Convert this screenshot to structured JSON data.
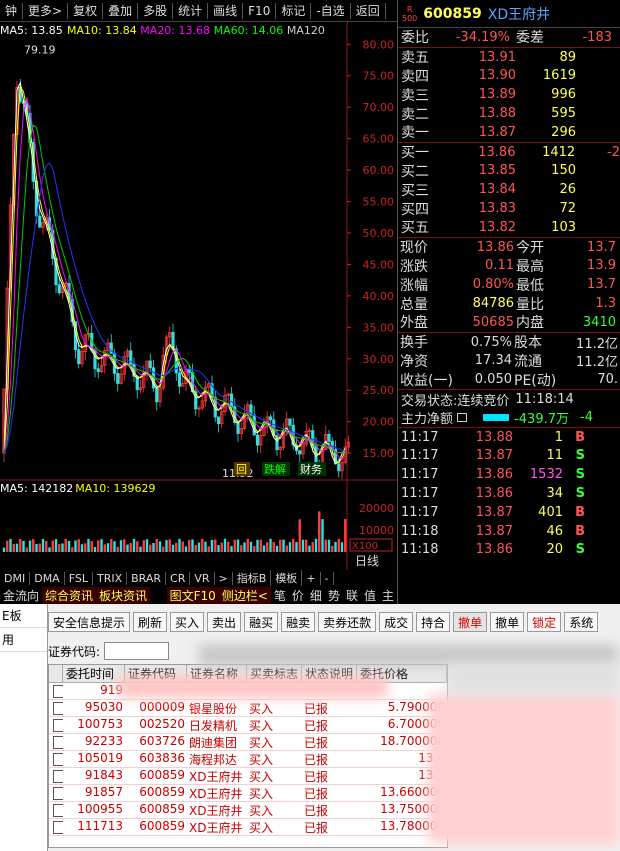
{
  "toolbar": {
    "items": [
      "钟",
      "更多>",
      "复权",
      "叠加",
      "多股",
      "统计",
      "画线",
      "F10",
      "标记",
      "-自选",
      "返回"
    ]
  },
  "chart": {
    "ma_legend": [
      {
        "label": "MA5: 13.85",
        "color": "#ffffff"
      },
      {
        "label": "MA10: 13.84",
        "color": "#ffff00"
      },
      {
        "label": "MA20: 13.68",
        "color": "#ff00ff"
      },
      {
        "label": "MA60: 14.06",
        "color": "#00ff00"
      },
      {
        "label": "MA120",
        "color": "#cccccc"
      }
    ],
    "y_ticks": [
      "80.00",
      "75.00",
      "70.00",
      "65.00",
      "60.00",
      "55.00",
      "50.00",
      "45.00",
      "40.00",
      "35.00",
      "30.00",
      "25.00",
      "20.00",
      "15.00"
    ],
    "high_label": "79.19",
    "low_label": "11.52",
    "markers": [
      "回",
      "跌解",
      "财务"
    ],
    "vol_legend": [
      {
        "label": "MA5: 142182",
        "color": "#ffffff"
      },
      {
        "label": "MA10: 139629",
        "color": "#ffff00"
      }
    ],
    "vol_ticks": [
      "20000",
      "10000",
      "X100"
    ],
    "period": "日线"
  },
  "chart_data": {
    "type": "candlestick",
    "y_range": [
      12,
      81
    ],
    "note_high": 79.19,
    "note_low": 11.52,
    "indicators": {
      "MA5": 13.85,
      "MA10": 13.84,
      "MA20": 13.68,
      "MA60": 14.06
    },
    "vol_indicators": {
      "MA5": 142182,
      "MA10": 139629
    }
  },
  "bottom_tabs": [
    "DMI",
    "DMA",
    "FSL",
    "TRIX",
    "BRAR",
    "CR",
    "VR",
    ">",
    "指标B",
    "模板",
    "+",
    "-"
  ],
  "bottom_nav": {
    "left": [
      "金流向",
      "综合资讯",
      "板块资讯"
    ],
    "right": [
      "图文F10",
      "侧边栏<",
      "笔",
      "价",
      "细",
      "势",
      "联",
      "值",
      "主"
    ]
  },
  "quote": {
    "code": "600859",
    "name": "XD王府井",
    "badge": [
      "R",
      "500"
    ],
    "weibi_label": "委比",
    "weibi": "-34.19%",
    "weicha_label": "委差",
    "weicha": "-183",
    "asks": [
      {
        "label": "卖五",
        "price": "13.91",
        "vol": "89"
      },
      {
        "label": "卖四",
        "price": "13.90",
        "vol": "1619"
      },
      {
        "label": "卖三",
        "price": "13.89",
        "vol": "996"
      },
      {
        "label": "卖二",
        "price": "13.88",
        "vol": "595"
      },
      {
        "label": "卖一",
        "price": "13.87",
        "vol": "296"
      }
    ],
    "bids": [
      {
        "label": "买一",
        "price": "13.86",
        "vol": "1412",
        "ext": "-2"
      },
      {
        "label": "买二",
        "price": "13.85",
        "vol": "150",
        "ext": ""
      },
      {
        "label": "买三",
        "price": "13.84",
        "vol": "26",
        "ext": ""
      },
      {
        "label": "买四",
        "price": "13.83",
        "vol": "72",
        "ext": ""
      },
      {
        "label": "买五",
        "price": "13.82",
        "vol": "103",
        "ext": ""
      }
    ],
    "stats": [
      {
        "l1": "现价",
        "v1": "13.86",
        "c1": "#ff5555",
        "l2": "今开",
        "v2": "13.7",
        "c2": "#ff5555"
      },
      {
        "l1": "涨跌",
        "v1": "0.11",
        "c1": "#ff5555",
        "l2": "最高",
        "v2": "13.9",
        "c2": "#ff5555"
      },
      {
        "l1": "涨幅",
        "v1": "0.80%",
        "c1": "#ff5555",
        "l2": "最低",
        "v2": "13.7",
        "c2": "#ff5555"
      },
      {
        "l1": "总量",
        "v1": "84786",
        "c1": "#ffff55",
        "l2": "量比",
        "v2": "1.3",
        "c2": "#ff5555"
      },
      {
        "l1": "外盘",
        "v1": "50685",
        "c1": "#ff5555",
        "l2": "内盘",
        "v2": "3410",
        "c2": "#33ff33"
      }
    ],
    "stats2": [
      {
        "l1": "换手",
        "v1": "0.75%",
        "l2": "股本",
        "v2": "11.2亿"
      },
      {
        "l1": "净资",
        "v1": "17.34",
        "l2": "流通",
        "v2": "11.2亿"
      },
      {
        "l1": "收益(一)",
        "v1": "0.050",
        "l2": "PE(动)",
        "v2": "70."
      }
    ],
    "status_label": "交易状态:",
    "status": "连续竞价",
    "status_time": "11:18:14",
    "flow_label": "主力净额",
    "flow_value": "-439.7万",
    "flow_ext": "-4",
    "ticks": [
      {
        "time": "11:17",
        "price": "13.88",
        "vol": "1",
        "side": "B",
        "vcolor": "#ffff55",
        "scolor": "#ff5555"
      },
      {
        "time": "11:17",
        "price": "13.87",
        "vol": "11",
        "side": "S",
        "vcolor": "#ffff55",
        "scolor": "#33ff33"
      },
      {
        "time": "11:17",
        "price": "13.86",
        "vol": "1532",
        "side": "S",
        "vcolor": "#ff55ff",
        "scolor": "#33ff33"
      },
      {
        "time": "11:17",
        "price": "13.86",
        "vol": "34",
        "side": "S",
        "vcolor": "#ffff55",
        "scolor": "#33ff33"
      },
      {
        "time": "11:17",
        "price": "13.87",
        "vol": "401",
        "side": "B",
        "vcolor": "#ffff55",
        "scolor": "#ff5555"
      },
      {
        "time": "11:18",
        "price": "13.87",
        "vol": "46",
        "side": "B",
        "vcolor": "#ffff55",
        "scolor": "#ff5555"
      },
      {
        "time": "11:18",
        "price": "13.86",
        "vol": "20",
        "side": "S",
        "vcolor": "#ffff55",
        "scolor": "#33ff33"
      }
    ]
  },
  "sidebar": {
    "items": [
      "E板",
      "用"
    ]
  },
  "trade": {
    "buttons": [
      "安全信息提示",
      "刷新",
      "买入",
      "卖出",
      "融买",
      "融卖",
      "卖券还款",
      "成交",
      "持合",
      "撤单",
      "撤单",
      "锁定",
      "系统"
    ],
    "code_label": "证券代码:",
    "columns": [
      "委托时间",
      "证券代码",
      "证券名称",
      "买卖标志",
      "状态说明",
      "委托价格"
    ],
    "rows": [
      {
        "time": "919",
        "code": "",
        "name": "",
        "side": "",
        "status": "",
        "price": ""
      },
      {
        "time": "95030",
        "code": "000009",
        "name": "银星股份",
        "side": "买入",
        "status": "已报",
        "price": "5.790000"
      },
      {
        "time": "100753",
        "code": "002520",
        "name": "日发精机",
        "side": "买入",
        "status": "已报",
        "price": "6.700000"
      },
      {
        "time": "92233",
        "code": "603726",
        "name": "朗迪集团",
        "side": "买入",
        "status": "已报",
        "price": "18.700000"
      },
      {
        "time": "105019",
        "code": "603836",
        "name": "海程邦达",
        "side": "买入",
        "status": "已报",
        "price": "13.6"
      },
      {
        "time": "91843",
        "code": "600859",
        "name": "XD王府井",
        "side": "买入",
        "status": "已报",
        "price": "13.7"
      },
      {
        "time": "91857",
        "code": "600859",
        "name": "XD王府井",
        "side": "买入",
        "status": "已报",
        "price": "13.660000"
      },
      {
        "time": "100955",
        "code": "600859",
        "name": "XD王府井",
        "side": "买入",
        "status": "已报",
        "price": "13.750000"
      },
      {
        "time": "111713",
        "code": "600859",
        "name": "XD王府井",
        "side": "买入",
        "status": "已报",
        "price": "13.780000"
      }
    ]
  }
}
